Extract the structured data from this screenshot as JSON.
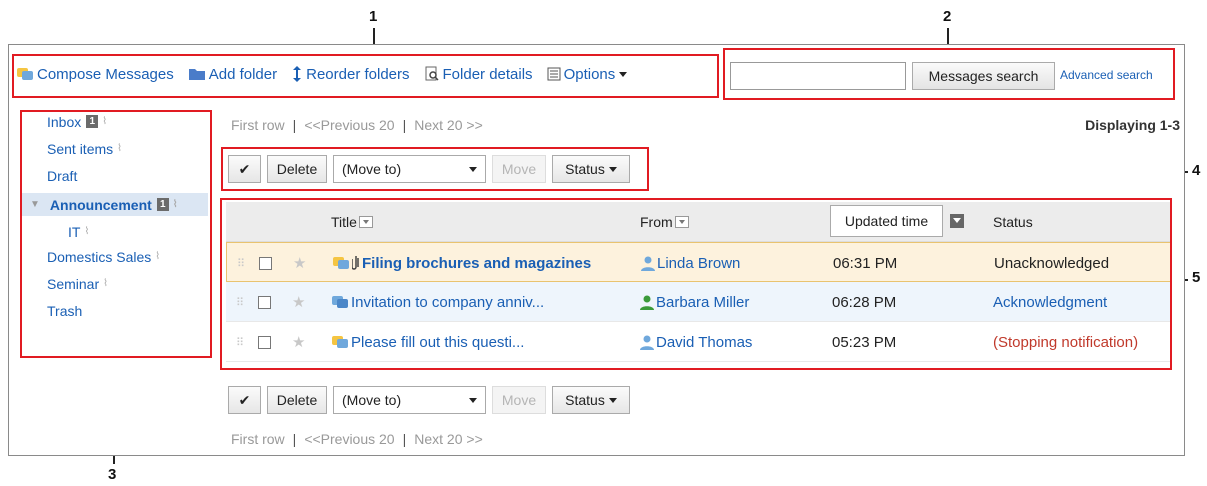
{
  "callouts": [
    "1",
    "2",
    "3",
    "4",
    "5"
  ],
  "toolbar": {
    "compose": "Compose Messages",
    "add_folder": "Add folder",
    "reorder": "Reorder folders",
    "details": "Folder details",
    "options": "Options"
  },
  "search": {
    "value": "",
    "button": "Messages search",
    "advanced": "Advanced search"
  },
  "sidebar": {
    "folders": [
      {
        "label": "Inbox",
        "count": "1"
      },
      {
        "label": "Sent items"
      },
      {
        "label": "Draft"
      },
      {
        "label": "Announcement",
        "count": "1"
      },
      {
        "label": "IT"
      },
      {
        "label": "Domestics Sales"
      },
      {
        "label": "Seminar"
      },
      {
        "label": "Trash"
      }
    ]
  },
  "pager": {
    "first": "First row",
    "prev": "<<Previous 20",
    "next": "Next 20 >>",
    "displaying": "Displaying 1-3"
  },
  "actions": {
    "check": "✔",
    "delete": "Delete",
    "move_to": "(Move to)",
    "move": "Move",
    "status": "Status"
  },
  "table": {
    "headers": {
      "title": "Title",
      "from": "From",
      "updated": "Updated time",
      "status": "Status"
    },
    "rows": [
      {
        "title": "Filing brochures and magazines",
        "from": "Linda Brown",
        "time": "06:31 PM",
        "status": "Unacknowledged"
      },
      {
        "title": "Invitation to company anniv...",
        "from": "Barbara Miller",
        "time": "06:28 PM",
        "status": "Acknowledgment"
      },
      {
        "title": "Please fill out this questi...",
        "from": "David Thomas",
        "time": "05:23 PM",
        "status": "(Stopping notification)"
      }
    ]
  },
  "colors": {
    "link": "#1a5fb4",
    "callout_red": "#e11b22",
    "status_acknowledged": "#1a5fb4",
    "status_stopping": "#c0392b",
    "row_highlight": "#fdf2dd"
  }
}
